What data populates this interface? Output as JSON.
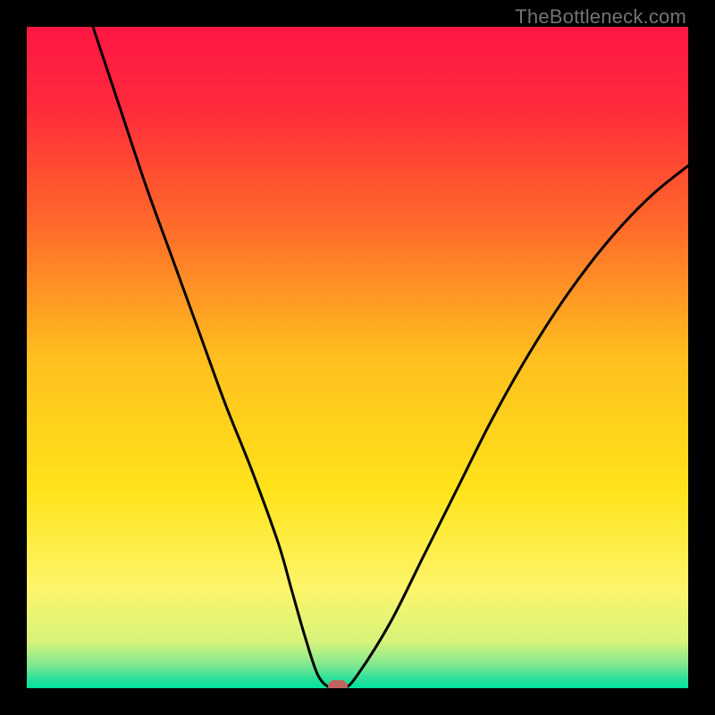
{
  "watermark": "TheBottleneck.com",
  "chart_data": {
    "type": "line",
    "title": "",
    "xlabel": "",
    "ylabel": "",
    "xlim": [
      0,
      100
    ],
    "ylim": [
      0,
      100
    ],
    "grid": false,
    "legend": false,
    "gradient_stops": [
      {
        "pos": 0.0,
        "color": "#ff1744"
      },
      {
        "pos": 0.12,
        "color": "#ff2a3c"
      },
      {
        "pos": 0.3,
        "color": "#ff6a2a"
      },
      {
        "pos": 0.5,
        "color": "#ffbf1f"
      },
      {
        "pos": 0.7,
        "color": "#ffe31a"
      },
      {
        "pos": 0.85,
        "color": "#fdf56b"
      },
      {
        "pos": 0.93,
        "color": "#d6f37a"
      },
      {
        "pos": 0.965,
        "color": "#7fe890"
      },
      {
        "pos": 0.985,
        "color": "#2fe09a"
      },
      {
        "pos": 1.0,
        "color": "#00e39b"
      }
    ],
    "series": [
      {
        "name": "bottleneck-curve",
        "x": [
          10,
          14,
          18,
          22,
          26,
          30,
          34,
          38,
          40,
          42,
          44,
          46,
          48,
          50,
          55,
          60,
          65,
          70,
          75,
          80,
          85,
          90,
          95,
          100
        ],
        "y": [
          100,
          88,
          76,
          65,
          54,
          43,
          33,
          22,
          15,
          8,
          2,
          0,
          0,
          2,
          10,
          20,
          30,
          40,
          49,
          57,
          64,
          70,
          75,
          79
        ]
      }
    ],
    "optimal_point": {
      "x": 47,
      "y": 0
    },
    "marker_color": "#c0645f"
  }
}
